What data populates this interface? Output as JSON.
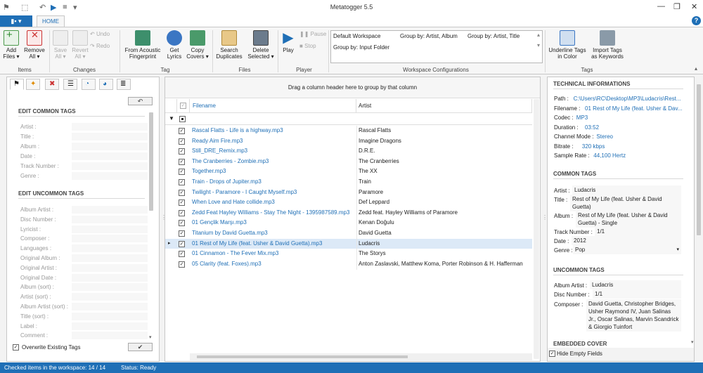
{
  "app": {
    "title": "Metatogger 5.5",
    "file_tab": "▮▪ ▾",
    "home_tab": "HOME",
    "help": "?"
  },
  "window": {
    "minimize": "—",
    "restore": "❐",
    "close": "✕"
  },
  "ribbon": {
    "add": "Add\nFiles ▾",
    "remove": "Remove\nAll ▾",
    "save": "Save\nAll ▾",
    "revert": "Revert\nAll ▾",
    "undo": "Undo",
    "redo": "Redo",
    "from_acoustic": "From Acoustic\nFingerprint",
    "get_lyrics": "Get\nLyrics",
    "copy_covers": "Copy\nCovers ▾",
    "search_dup": "Search\nDuplicates",
    "delete_sel": "Delete\nSelected ▾",
    "play": "Play",
    "pause": "Pause",
    "stop": "Stop",
    "ws_default": "Default Workspace",
    "ws_artist_album": "Group by: Artist, Album",
    "ws_artist_title": "Group by: Artist, Title",
    "ws_input_folder": "Group by: Input Folder",
    "underline": "Underline Tags\nin Color",
    "import_kw": "Import Tags\nas Keywords",
    "groups": {
      "items": "Items",
      "changes": "Changes",
      "tag": "Tag",
      "files": "Files",
      "player": "Player",
      "workspace": "Workspace Configurations",
      "tags": "Tags"
    }
  },
  "left": {
    "common_title": "EDIT COMMON TAGS",
    "common_fields": [
      "Artist :",
      "Title :",
      "Album :",
      "Date :",
      "Track Number :",
      "Genre :"
    ],
    "uncommon_title": "EDIT UNCOMMON TAGS",
    "uncommon_fields": [
      "Album Artist :",
      "Disc Number :",
      "Lyricist :",
      "Composer :",
      "Languages :",
      "Original Album :",
      "Original Artist :",
      "Original Date :",
      "Album (sort) :",
      "Artist (sort) :",
      "Album Artist (sort) :",
      "Title (sort) :",
      "Label :",
      "Comment :"
    ],
    "overwrite": "Overwrite Existing Tags",
    "revert_btn": "↶",
    "apply_btn": "✔"
  },
  "grid": {
    "group_hint": "Drag a column header here to group by that column",
    "col_filename": "Filename",
    "col_artist": "Artist",
    "rows": [
      {
        "file": "Rascal Flatts - Life is a highway.mp3",
        "artist": "Rascal Flatts"
      },
      {
        "file": "Ready Aim Fire.mp3",
        "artist": "Imagine Dragons"
      },
      {
        "file": "Still_DRE_Remix.mp3",
        "artist": "D.R.E."
      },
      {
        "file": "The Cranberries - Zombie.mp3",
        "artist": "The Cranberries"
      },
      {
        "file": "Together.mp3",
        "artist": "The XX"
      },
      {
        "file": "Train - Drops of Jupiter.mp3",
        "artist": "Train"
      },
      {
        "file": "Twilight - Paramore - I Caught Myself.mp3",
        "artist": "Paramore"
      },
      {
        "file": "When Love and Hate collide.mp3",
        "artist": "Def Leppard"
      },
      {
        "file": "Zedd Feat Hayley Williams - Stay The Night - 1395987589.mp3",
        "artist": "Zedd feat. Hayley Williams of Paramore"
      },
      {
        "file": "01 Gençlik Marşı.mp3",
        "artist": "Kenan Doğulu"
      },
      {
        "file": "Titanium by David Guetta.mp3",
        "artist": "David Guetta"
      },
      {
        "file": "01 Rest of My Life (feat. Usher & David Guetta).mp3",
        "artist": "Ludacris"
      },
      {
        "file": "01 Cinnamon - The Fever Mix.mp3",
        "artist": "The Storys"
      },
      {
        "file": "05 Clarity (feat. Foxes).mp3",
        "artist": "Anton Zaslavski, Matthew Koma, Porter Robinson & H. Hafferman"
      }
    ]
  },
  "right": {
    "tech_title": "TECHNICAL INFORMATIONS",
    "tech": [
      {
        "k": "Path :",
        "v": "C:\\Users\\RC\\Desktop\\MP3\\Ludacris\\Rest..."
      },
      {
        "k": "Filename :",
        "v": "01 Rest of My Life (feat. Usher & Dav..."
      },
      {
        "k": "Codec :",
        "v": "MP3"
      },
      {
        "k": "Duration :",
        "v": "03:52"
      },
      {
        "k": "Channel Mode :",
        "v": "Stereo"
      },
      {
        "k": "Bitrate :",
        "v": "320 kbps"
      },
      {
        "k": "Sample Rate :",
        "v": "44,100 Hertz"
      }
    ],
    "common_title": "COMMON TAGS",
    "artist_k": "Artist :",
    "artist_v": "Ludacris",
    "title_k": "Title :",
    "title_v": "Rest of My Life (feat. Usher & David Guetta)",
    "album_k": "Album :",
    "album_v": "Rest of My Life (feat. Usher & David Guetta) - Single",
    "track_k": "Track Number :",
    "track_v": "1/1",
    "date_k": "Date :",
    "date_v": "2012",
    "genre_k": "Genre :",
    "genre_v": "Pop",
    "uncommon_title": "UNCOMMON TAGS",
    "albumartist_k": "Album Artist :",
    "albumartist_v": "Ludacris",
    "disc_k": "Disc Number :",
    "disc_v": "1/1",
    "composer_k": "Composer :",
    "composer_v": "David Guetta, Christopher Bridges, Usher Raymond IV, Juan Salinas Jr., Oscar Salinas, Marvin Scandrick & Giorgio Tuinfort",
    "cover_title": "EMBEDDED COVER",
    "hide_empty": "Hide Empty Fields"
  },
  "status": {
    "checked": "Checked items in the workspace: 14 / 14",
    "status": "Status: Ready"
  }
}
